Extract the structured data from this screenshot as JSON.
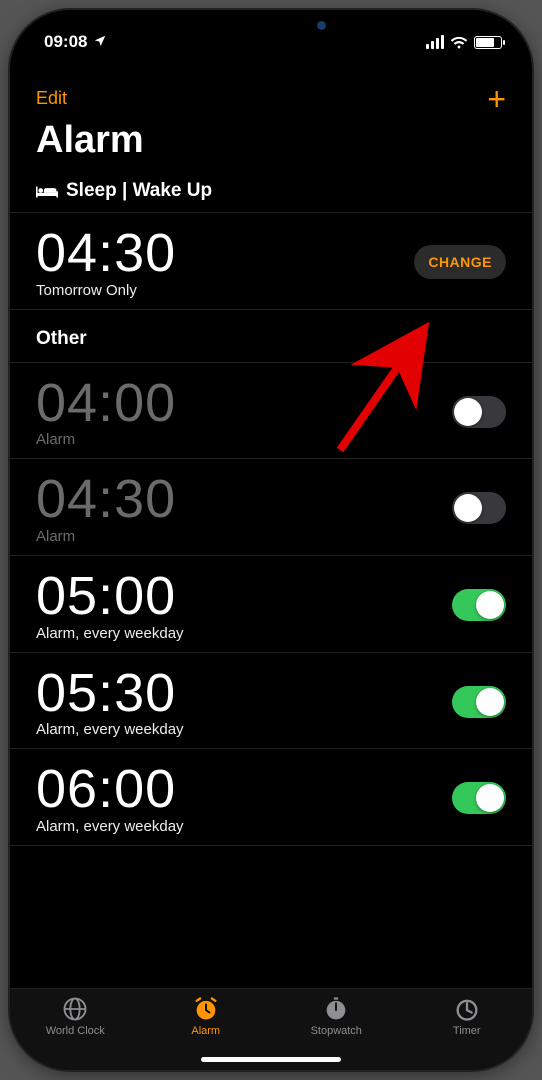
{
  "statusbar": {
    "time": "09:08"
  },
  "navbar": {
    "edit_label": "Edit"
  },
  "title": "Alarm",
  "sleep_wake": {
    "header": "Sleep | Wake Up",
    "time": "04:30",
    "sub": "Tomorrow Only",
    "change_label": "CHANGE"
  },
  "other_header": "Other",
  "alarms": [
    {
      "time": "04:00",
      "sub": "Alarm",
      "on": false
    },
    {
      "time": "04:30",
      "sub": "Alarm",
      "on": false
    },
    {
      "time": "05:00",
      "sub": "Alarm, every weekday",
      "on": true
    },
    {
      "time": "05:30",
      "sub": "Alarm, every weekday",
      "on": true
    },
    {
      "time": "06:00",
      "sub": "Alarm, every weekday",
      "on": true
    }
  ],
  "tabs": {
    "world_clock": "World Clock",
    "alarm": "Alarm",
    "stopwatch": "Stopwatch",
    "timer": "Timer"
  }
}
